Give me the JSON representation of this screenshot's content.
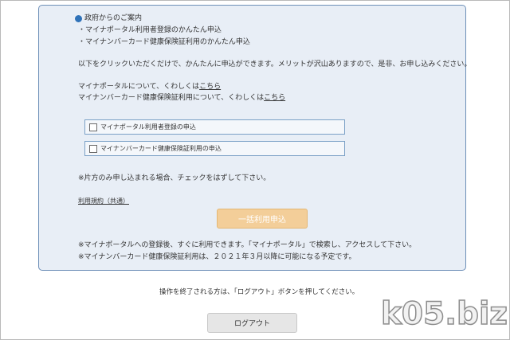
{
  "notice": {
    "heading": "政府からのご案内",
    "items": [
      "・マイナポータル利用者登録のかんたん申込",
      "・マイナンバーカード健康保険証利用のかんたん申込"
    ],
    "intro": "以下をクリックいただくだけで、かんたんに申込ができます。メリットが沢山ありますので、是非、お申し込みください。",
    "portal_info_prefix": "マイナポータルについて、くわしくは",
    "portal_info_link": "こちら",
    "card_info_prefix": "マイナンバーカード健康保険証利用について、くわしくは",
    "card_info_link": "こちら"
  },
  "options": [
    {
      "label": "マイナポータル利用者登録の申込",
      "checked": false
    },
    {
      "label": "マイナンバーカード健康保険証利用の申込",
      "checked": false
    }
  ],
  "partial_note": "※片方のみ申し込まれる場合、チェックをはずして下さい。",
  "terms_link": "利用規約（共通）",
  "apply_button": "一括利用申込",
  "footnotes": [
    "※マイナポータルへの登録後、すぐに利用できます。「マイナポータル」で検索し、アクセスして下さい。",
    "※マイナンバーカード健康保険証利用は、２０２１年３月以降に可能になる予定です。"
  ],
  "logout_note": "操作を終了される方は、「ログアウト」ボタンを押してください。",
  "logout_button": "ログアウト",
  "watermark": "k05.biz",
  "colors": {
    "panel_bg": "#e8eef6",
    "panel_border": "#6d8fb8",
    "info_icon": "#2f72b8",
    "apply_button_bg": "#f3ce99",
    "logout_button_bg": "#e6e6e6"
  }
}
